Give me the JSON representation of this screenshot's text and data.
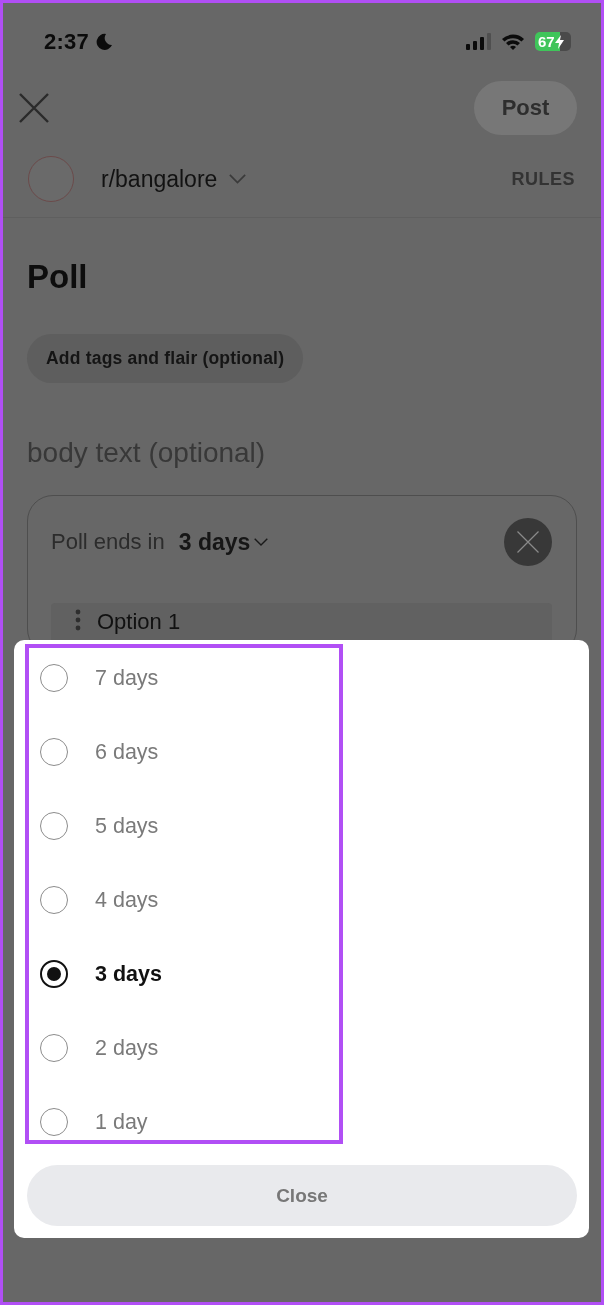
{
  "status_bar": {
    "time": "2:37",
    "battery": "67"
  },
  "header": {
    "post_button": {
      "label": "Post",
      "disabled": true
    }
  },
  "community": {
    "name": "r/bangalore",
    "rules": "RULES"
  },
  "title": "Poll",
  "tags_button": "Add tags and flair (optional)",
  "body": {
    "placeholder": "body text (optional)"
  },
  "poll": {
    "ends_label": "Poll ends in",
    "duration": "3 days",
    "options": [
      {
        "placeholder": "Option 1"
      }
    ]
  },
  "duration_sheet": {
    "options": [
      {
        "label": "7 days",
        "selected": false
      },
      {
        "label": "6 days",
        "selected": false
      },
      {
        "label": "5 days",
        "selected": false
      },
      {
        "label": "4 days",
        "selected": false
      },
      {
        "label": "3 days",
        "selected": true
      },
      {
        "label": "2 days",
        "selected": false
      },
      {
        "label": "1 day",
        "selected": false
      }
    ],
    "close": "Close"
  }
}
